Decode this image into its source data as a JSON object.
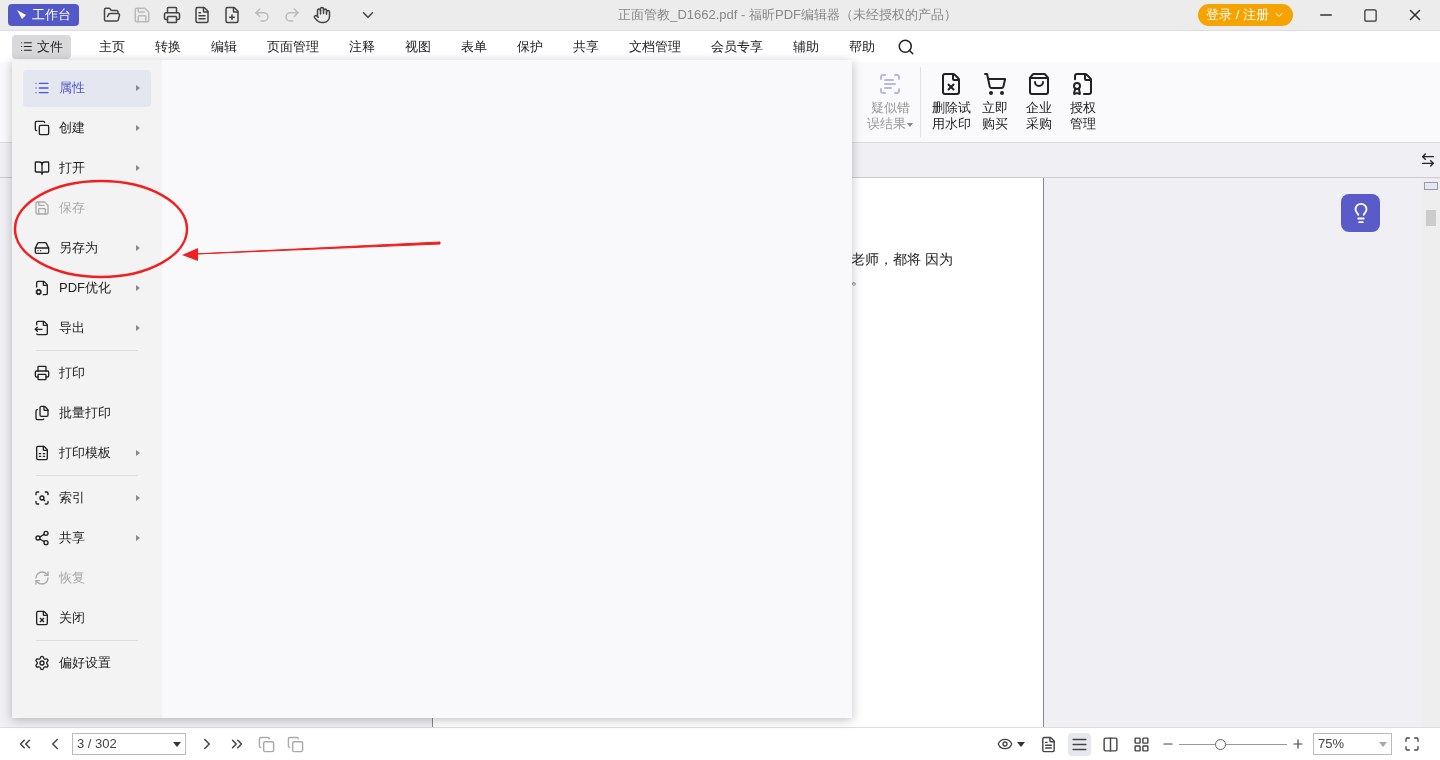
{
  "titlebar": {
    "workbench_button": "工作台",
    "title": "正面管教_D1662.pdf - 福昕PDF编辑器（未经授权的产品）",
    "login_button": "登录 / 注册"
  },
  "menu_tabs": [
    {
      "label": "文件",
      "selected": true
    },
    {
      "label": "主页",
      "selected": false
    },
    {
      "label": "转换",
      "selected": false
    },
    {
      "label": "编辑",
      "selected": false
    },
    {
      "label": "页面管理",
      "selected": false
    },
    {
      "label": "注释",
      "selected": false
    },
    {
      "label": "视图",
      "selected": false
    },
    {
      "label": "表单",
      "selected": false
    },
    {
      "label": "保护",
      "selected": false
    },
    {
      "label": "共享",
      "selected": false
    },
    {
      "label": "文档管理",
      "selected": false
    },
    {
      "label": "会员专享",
      "selected": false
    },
    {
      "label": "辅助",
      "selected": false
    },
    {
      "label": "帮助",
      "selected": false
    }
  ],
  "ribbon": [
    {
      "lines": [
        "疑似错",
        "误结果"
      ],
      "disabled": true,
      "dropdown": true
    },
    {
      "lines": [
        "删除试",
        "用水印"
      ],
      "disabled": false,
      "dropdown": false
    },
    {
      "lines": [
        "立即",
        "购买"
      ],
      "disabled": false,
      "dropdown": false
    },
    {
      "lines": [
        "企业",
        "采购"
      ],
      "disabled": false,
      "dropdown": false
    },
    {
      "lines": [
        "授权",
        "管理"
      ],
      "disabled": false,
      "dropdown": false
    }
  ],
  "document": {
    "lines": [
      "老师，都将 因为",
      "。"
    ]
  },
  "file_menu": [
    {
      "kind": "item",
      "label": "属性",
      "submenu": true,
      "disabled": false,
      "selected": true
    },
    {
      "kind": "item",
      "label": "创建",
      "submenu": true,
      "disabled": false,
      "selected": false
    },
    {
      "kind": "item",
      "label": "打开",
      "submenu": true,
      "disabled": false,
      "selected": false
    },
    {
      "kind": "item",
      "label": "保存",
      "submenu": false,
      "disabled": true,
      "selected": false
    },
    {
      "kind": "item",
      "label": "另存为",
      "submenu": true,
      "disabled": false,
      "selected": false
    },
    {
      "kind": "item",
      "label": "PDF优化",
      "submenu": true,
      "disabled": false,
      "selected": false
    },
    {
      "kind": "item",
      "label": "导出",
      "submenu": true,
      "disabled": false,
      "selected": false
    },
    {
      "kind": "separator"
    },
    {
      "kind": "item",
      "label": "打印",
      "submenu": false,
      "disabled": false,
      "selected": false
    },
    {
      "kind": "item",
      "label": "批量打印",
      "submenu": false,
      "disabled": false,
      "selected": false
    },
    {
      "kind": "item",
      "label": "打印模板",
      "submenu": true,
      "disabled": false,
      "selected": false
    },
    {
      "kind": "separator"
    },
    {
      "kind": "item",
      "label": "索引",
      "submenu": true,
      "disabled": false,
      "selected": false
    },
    {
      "kind": "item",
      "label": "共享",
      "submenu": true,
      "disabled": false,
      "selected": false
    },
    {
      "kind": "item",
      "label": "恢复",
      "submenu": false,
      "disabled": true,
      "selected": false
    },
    {
      "kind": "item",
      "label": "关闭",
      "submenu": false,
      "disabled": false,
      "selected": false
    },
    {
      "kind": "separator"
    },
    {
      "kind": "item",
      "label": "偏好设置",
      "submenu": false,
      "disabled": false,
      "selected": false
    }
  ],
  "status_bar": {
    "page_field": "3 / 302",
    "view_modes": [
      {
        "selected": false
      },
      {
        "selected": true
      },
      {
        "selected": false
      },
      {
        "selected": false
      }
    ],
    "zoom_slider": {
      "level": 0.38
    },
    "zoom_field": "75%"
  }
}
